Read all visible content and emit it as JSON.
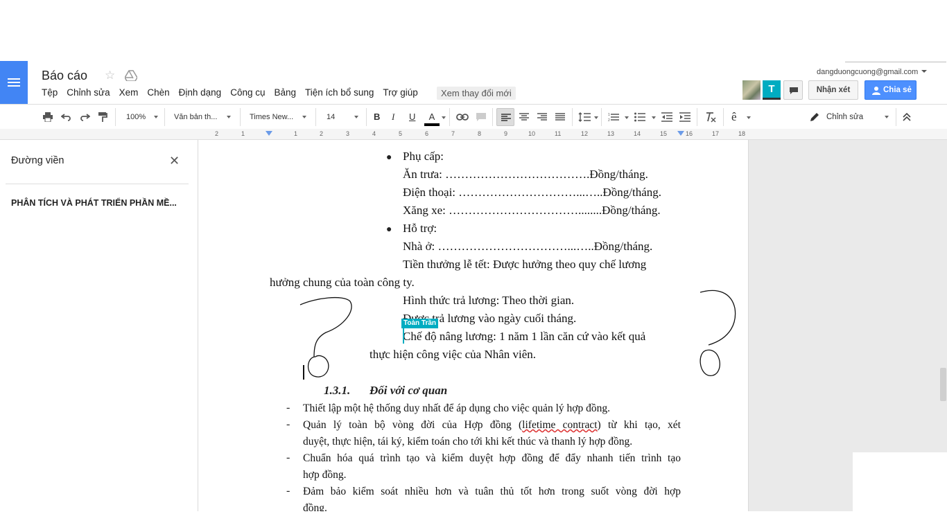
{
  "header": {
    "doc_title": "Báo cáo",
    "menu": [
      "Tệp",
      "Chỉnh sửa",
      "Xem",
      "Chèn",
      "Định dạng",
      "Công cụ",
      "Bảng",
      "Tiện ích bổ sung",
      "Trợ giúp"
    ],
    "last_edit": "Xem thay đổi mới",
    "account_email": "dangduongcuong@gmail.com",
    "avatar_initial": "T",
    "comment_label": "Nhận xét",
    "share_label": "Chia sẻ"
  },
  "toolbar": {
    "zoom": "100%",
    "style": "Văn bản th...",
    "font": "Times New...",
    "font_size": "14",
    "bold": "B",
    "italic": "I",
    "underline": "U",
    "text_color": "A",
    "input_tools": "ê",
    "mode": "Chỉnh sửa"
  },
  "ruler": {
    "ticks": [
      "2",
      "1",
      "1",
      "2",
      "3",
      "4",
      "5",
      "6",
      "7",
      "8",
      "9",
      "10",
      "11",
      "12",
      "13",
      "14",
      "15",
      "16",
      "17",
      "18"
    ]
  },
  "outline": {
    "title": "Đường viền",
    "heading": "PHÂN TÍCH VÀ PHÁT TRIỂN PHẦN MỀ..."
  },
  "document": {
    "allowance_bullet": "Phụ cấp:",
    "lunch": "Ăn trưa: ……………………………….Đồng/tháng.",
    "phone": "Điện thoại: …………………………...…..Đồng/tháng.",
    "gas": "Xăng xe: ……………………………........Đồng/tháng.",
    "support_bullet": "Hỗ trợ:",
    "housing": "Nhà ở: ……………………………...…..Đồng/tháng.",
    "bonus_line1": "Tiền thưởng lễ tết: Được hưởng theo quy chế lương",
    "bonus_line2": "hưởng chung của toàn công ty.",
    "pay_form": "Hình thức trả lương: Theo thời gian.",
    "pay_day": "Được trả lương vào ngày cuối tháng.",
    "raise_line1": "Chế độ nâng lương: 1 năm 1 lần căn cứ vào kết quả",
    "raise_line2": "thực hiện công việc của Nhân viên.",
    "section_number": "1.3.1.",
    "section_title": "Đối với cơ quan",
    "item1": "Thiết lập một hệ thống duy nhất để áp dụng cho việc quản lý hợp đồng.",
    "item2_line1_a": "Quản lý toàn bộ vòng đời của Hợp đồng (",
    "item2_line1_b": "lifetime contract",
    "item2_line1_c": ") từ khi tạo, xét",
    "item2_line2": "duyệt, thực hiện, tái ký, kiểm toán cho tới khi kết thúc và thanh lý hợp đồng.",
    "item3_line1": "Chuẩn hóa quá trình tạo và kiểm duyệt hợp đồng để đẩy nhanh tiến trình tạo",
    "item3_line2": "hợp đồng.",
    "item4_line1": "Đảm bảo kiểm soát nhiều hơn và tuân thủ tốt hơn trong suốt vòng đời hợp",
    "item4_line2": "đồng.",
    "collaborator": "Toàn Trần",
    "bullet_glyph": "●",
    "dash_glyph": "-"
  },
  "colors": {
    "brand_blue": "#4285f4",
    "share_blue": "#4d90fe",
    "collaborator_teal": "#00acc1"
  }
}
